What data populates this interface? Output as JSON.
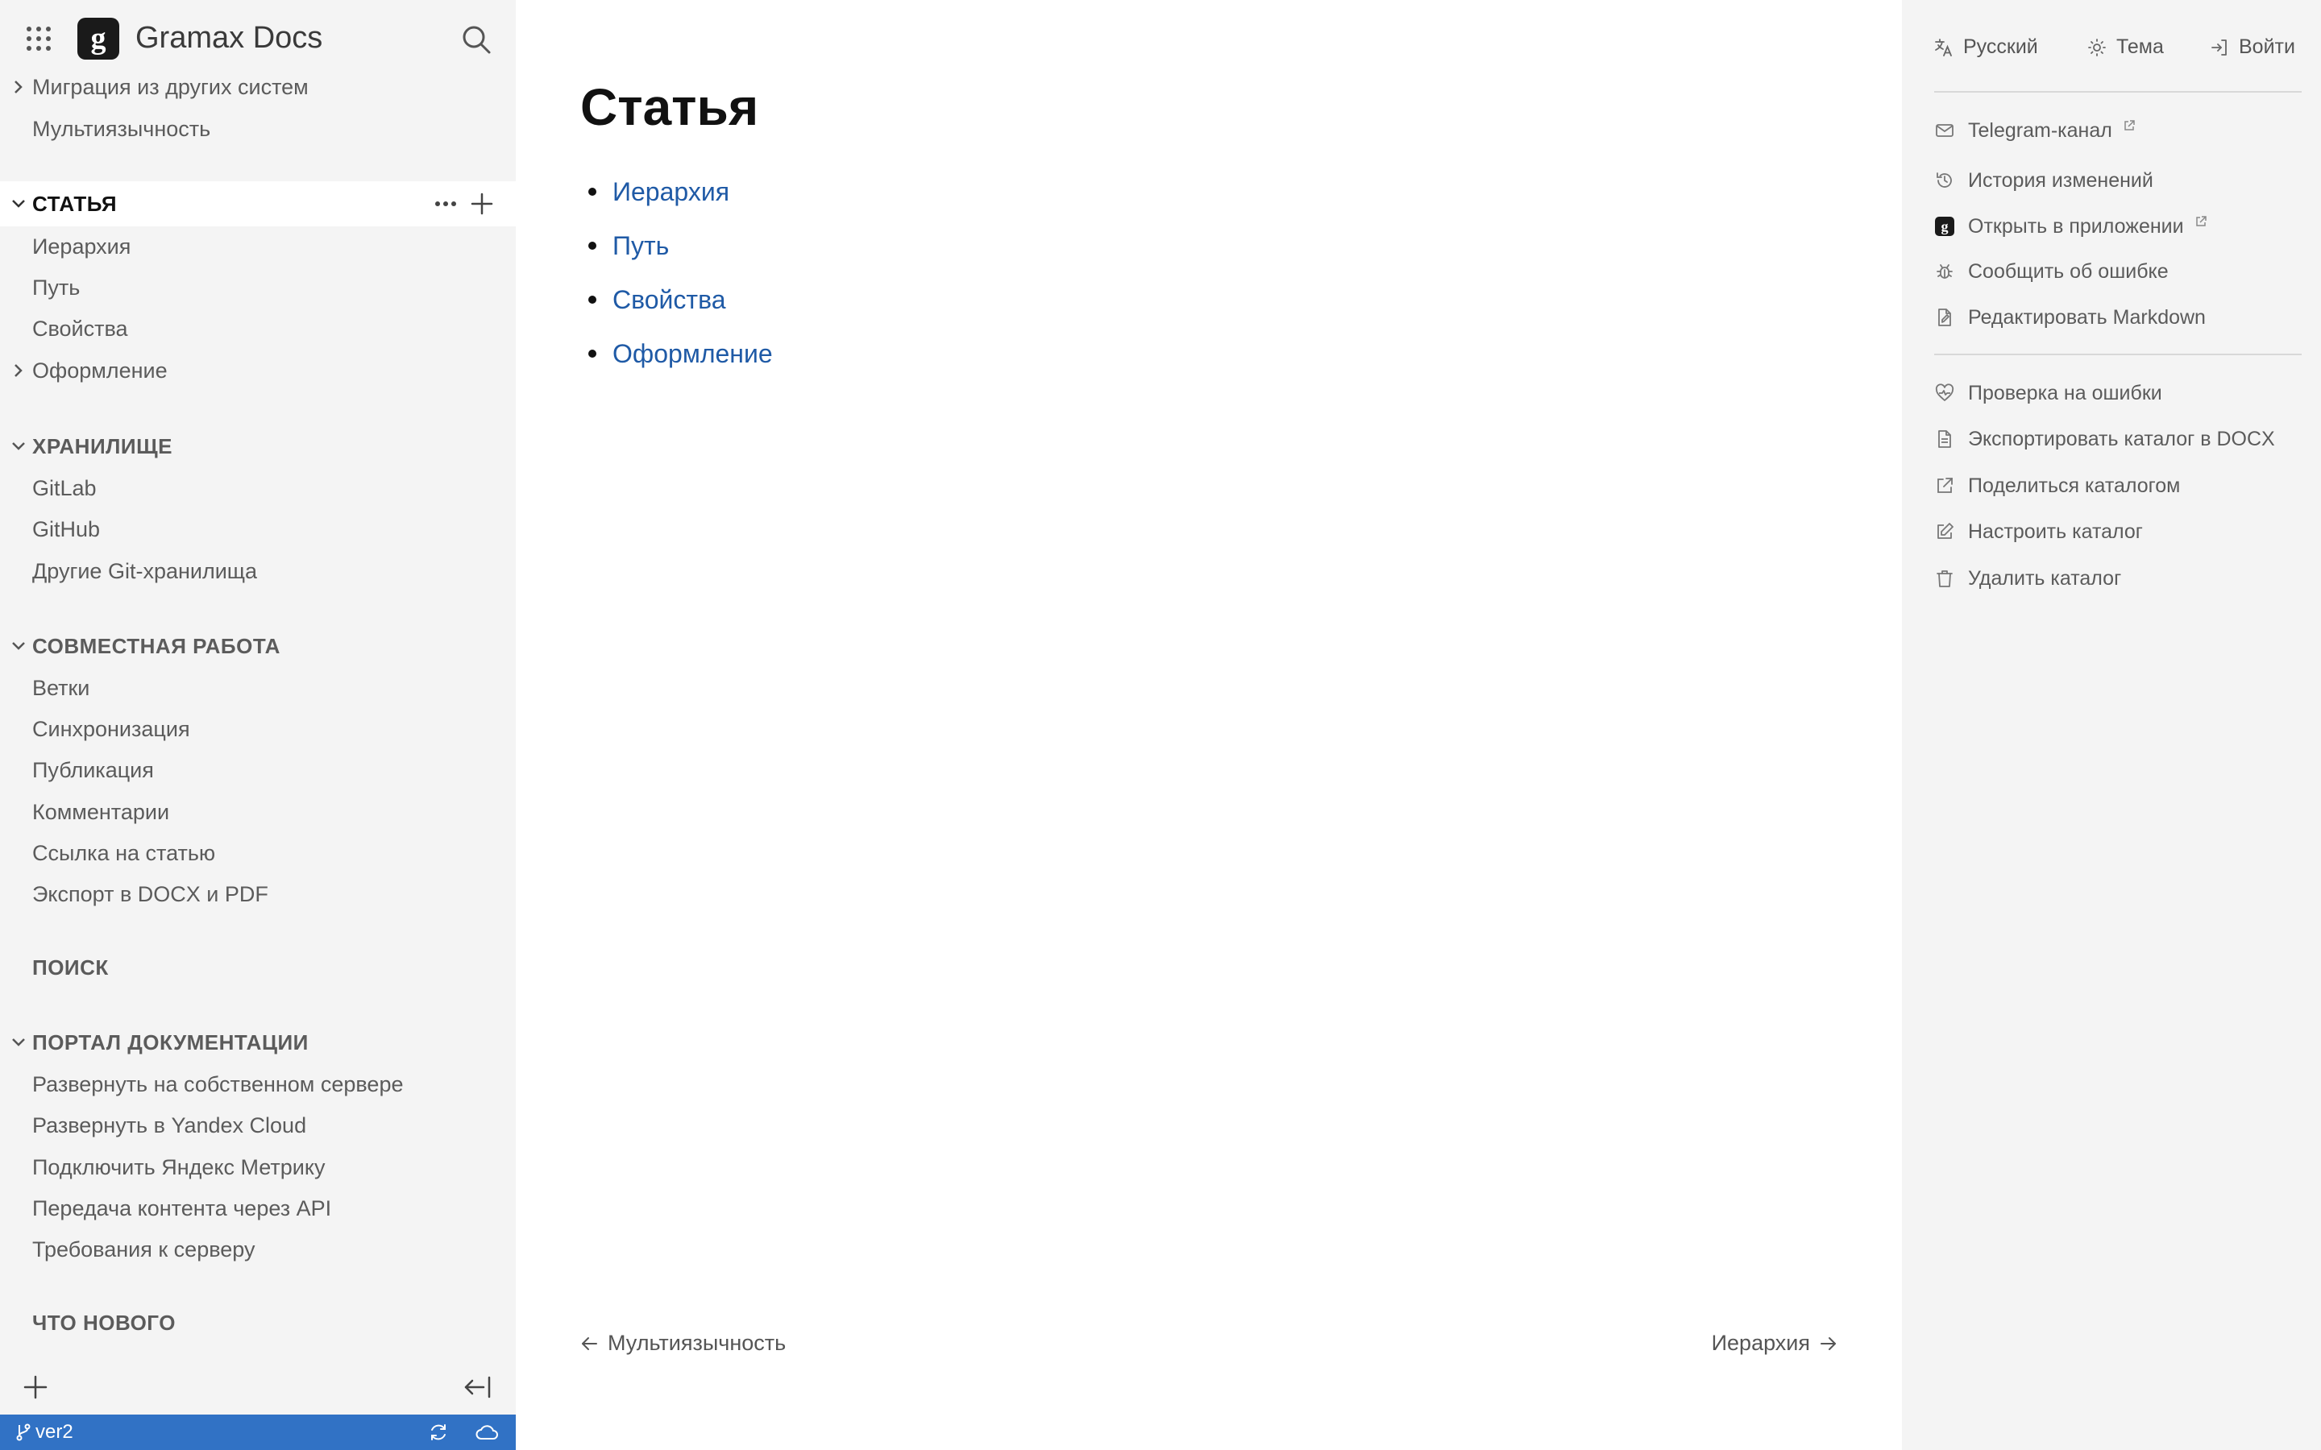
{
  "app": {
    "title": "Gramax Docs",
    "logo_letter": "g"
  },
  "colors": {
    "sidebar_bg": "#f4f4f4",
    "link": "#1f5aa6",
    "statusbar": "#3172c5"
  },
  "sidebar": {
    "items": {
      "migration": "Миграция из других систем",
      "multilang": "Мультиязычность",
      "article_section": "СТАТЬЯ",
      "hierarchy": "Иерархия",
      "path": "Путь",
      "properties": "Свойства",
      "design": "Оформление",
      "storage_section": "ХРАНИЛИЩЕ",
      "gitlab": "GitLab",
      "github": "GitHub",
      "other_git": "Другие Git-хранилища",
      "collab_section": "СОВМЕСТНАЯ РАБОТА",
      "branches": "Ветки",
      "sync": "Синхронизация",
      "publish": "Публикация",
      "comments": "Комментарии",
      "article_link": "Ссылка на статью",
      "export": "Экспорт в DOCX и PDF",
      "search_section": "ПОИСК",
      "portal_section": "ПОРТАЛ ДОКУМЕНТАЦИИ",
      "self_host": "Развернуть на собственном сервере",
      "yandex_cloud": "Развернуть в Yandex Cloud",
      "metrika": "Подключить Яндекс Метрику",
      "api": "Передача контента через API",
      "server_req": "Требования к серверу",
      "whats_new_section": "ЧТО НОВОГО"
    }
  },
  "statusbar": {
    "branch": "ver2"
  },
  "main": {
    "title": "Статья",
    "toc": [
      "Иерархия",
      "Путь",
      "Свойства",
      "Оформление"
    ],
    "prev": "Мультиязычность",
    "next": "Иерархия"
  },
  "rightpanel": {
    "language": "Русский",
    "theme": "Тема",
    "login": "Войти",
    "telegram": "Telegram-канал",
    "history": "История изменений",
    "open_app": "Открыть в приложении",
    "report_bug": "Сообщить об ошибке",
    "edit_md": "Редактировать Markdown",
    "check_errors": "Проверка на ошибки",
    "export_docx": "Экспортировать каталог в DOCX",
    "share": "Поделиться каталогом",
    "configure": "Настроить каталог",
    "delete": "Удалить каталог"
  }
}
